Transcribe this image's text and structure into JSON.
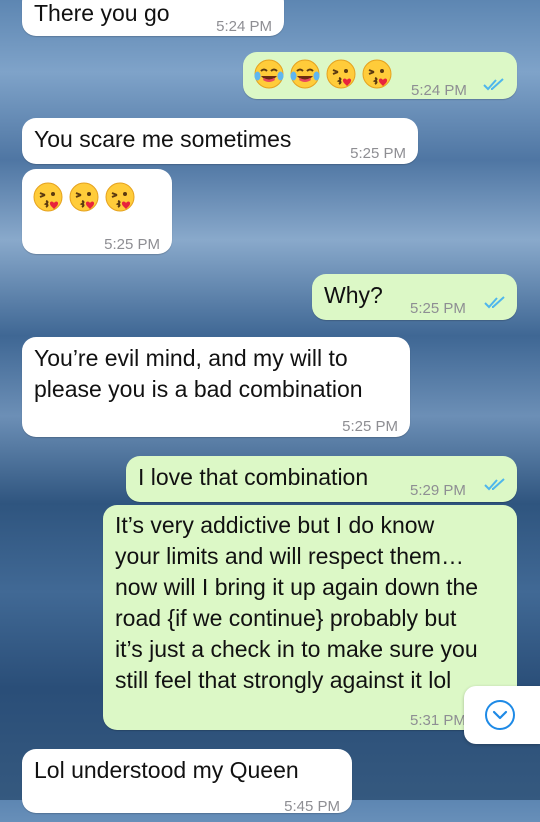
{
  "messages": [
    {
      "text": "There you go",
      "time": "5:24 PM"
    },
    {
      "emojis": [
        "tears-of-joy-face",
        "tears-of-joy-face",
        "face-blowing-kiss",
        "face-blowing-kiss"
      ],
      "time": "5:24 PM",
      "status": "read"
    },
    {
      "text": "You scare me sometimes",
      "time": "5:25 PM"
    },
    {
      "emojis": [
        "face-blowing-kiss",
        "face-blowing-kiss",
        "face-blowing-kiss"
      ],
      "time": "5:25 PM"
    },
    {
      "text": "Why?",
      "time": "5:25 PM",
      "status": "read"
    },
    {
      "lines": [
        "You’re evil mind, and my will to",
        "please you is a bad combination"
      ],
      "time": "5:25 PM"
    },
    {
      "text": "I love that combination",
      "time": "5:29 PM",
      "status": "read"
    },
    {
      "lines": [
        "It’s very addictive but I do know",
        "your limits and will respect them…",
        "now will I bring it up again down the",
        "road {if we continue} probably but",
        "it’s just a check in to make sure you",
        "still feel that strongly against it lol"
      ],
      "time": "5:31 PM",
      "status": "read"
    },
    {
      "text": "Lol understood my Queen",
      "time": "5:45 PM"
    }
  ],
  "colors": {
    "incoming": "#ffffff",
    "outgoing": "#dcf8c6",
    "read_ticks": "#4fb6ec",
    "timestamp": "#8e8e93"
  },
  "scroll_button": {
    "icon": "chevron-down-circle-icon"
  }
}
